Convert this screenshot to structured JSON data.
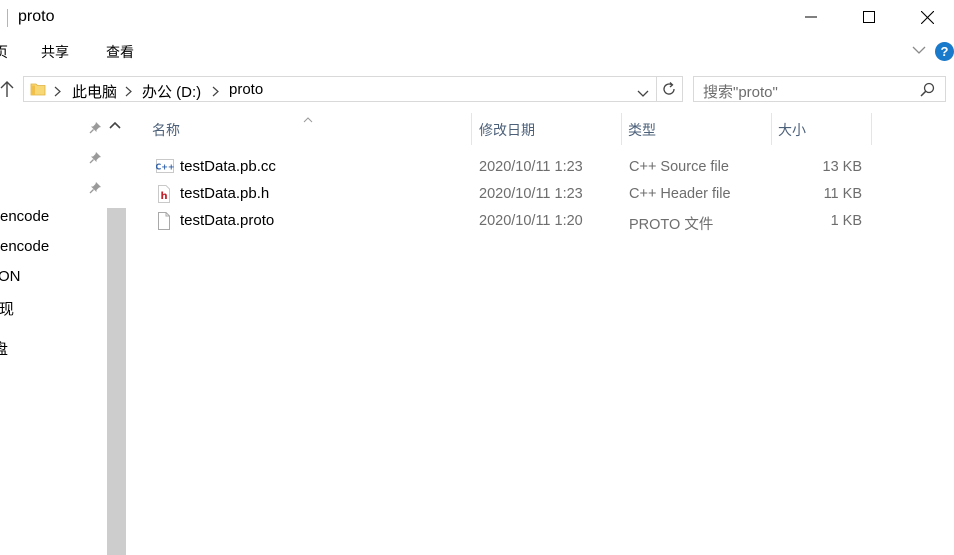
{
  "window": {
    "title": "proto",
    "minimize_icon": "minimize-icon",
    "maximize_icon": "maximize-icon",
    "close_icon": "close-icon"
  },
  "ribbon": {
    "tabs": [
      "页",
      "共享",
      "查看"
    ],
    "help_label": "?"
  },
  "address_bar": {
    "breadcrumbs": [
      "此电脑",
      "办公 (D:)",
      "proto"
    ]
  },
  "search": {
    "placeholder": "搜索\"proto\""
  },
  "nav_pane": {
    "items": [
      "encode",
      "encode",
      "ON",
      "现",
      "盘"
    ]
  },
  "file_list": {
    "columns": {
      "name": "名称",
      "date": "修改日期",
      "type": "类型",
      "size": "大小"
    },
    "files": [
      {
        "name": "testData.pb.cc",
        "date": "2020/10/11 1:23",
        "type": "C++ Source file",
        "size": "13 KB",
        "icon": "cpp-source-icon"
      },
      {
        "name": "testData.pb.h",
        "date": "2020/10/11 1:23",
        "type": "C++ Header file",
        "size": "11 KB",
        "icon": "cpp-header-icon"
      },
      {
        "name": "testData.proto",
        "date": "2020/10/11 1:20",
        "type": "PROTO 文件",
        "size": "1 KB",
        "icon": "blank-file-icon"
      }
    ]
  },
  "colors": {
    "help_blue": "#1979ca",
    "column_header_text": "#4c607a",
    "folder_yellow": "#f8d775",
    "header_file_red": "#c4202b",
    "source_file_blue": "#2d5ea6"
  }
}
